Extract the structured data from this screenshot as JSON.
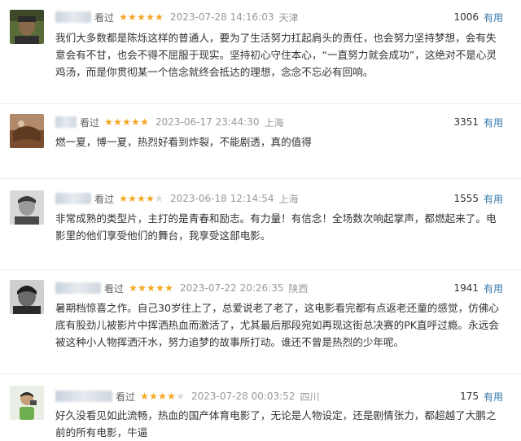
{
  "reviews": [
    {
      "watched": "看过",
      "rating": 5,
      "time": "2023-07-28 14:16:03",
      "location": "天津",
      "votes": "1006",
      "useful": "有用",
      "text": "我们大多数都是陈烁这样的普通人，要为了生活努力扛起肩头的责任，也会努力坚持梦想，会有失意会有不甘，也会不得不屈服于现实。坚持初心守住本心，“一直努力就会成功”，这绝对不是心灵鸡汤，而是你贯彻某一个信念就终会抵达的理想，念念不忘必有回响。"
    },
    {
      "watched": "看过",
      "rating": 5,
      "time": "2023-06-17 23:44:30",
      "location": "上海",
      "votes": "3351",
      "useful": "有用",
      "text": "燃一夏，博一夏，热烈好看到炸裂，不能剧透，真的值得"
    },
    {
      "watched": "看过",
      "rating": 4,
      "time": "2023-06-18 12:14:54",
      "location": "上海",
      "votes": "1555",
      "useful": "有用",
      "text": "非常成熟的类型片，主打的是青春和励志。有力量！有信念！全场数次响起掌声，都燃起来了。电影里的他们享受他们的舞台，我享受这部电影。"
    },
    {
      "watched": "看过",
      "rating": 5,
      "time": "2023-07-22 20:26:35",
      "location": "陕西",
      "votes": "1941",
      "useful": "有用",
      "text": "暑期档惊喜之作。自己30岁往上了，总爱说老了老了，这电影看完都有点返老还童的感觉，仿佛心底有股劲儿被影片中挥洒热血而激活了，尤其最后那段宛如再现这街总决赛的PK直呼过瘾。永远会被这种小人物挥洒汗水，努力追梦的故事所打动。谁还不曾是热烈的少年呢。"
    },
    {
      "watched": "看过",
      "rating": 4,
      "time": "2023-07-28 00:03:52",
      "location": "四川",
      "votes": "175",
      "useful": "有用",
      "text": "好久没看见如此流畅，热血的国产体育电影了，无论是人物设定，还是剧情张力，都超越了大鹏之前的所有电影，牛逼"
    }
  ]
}
